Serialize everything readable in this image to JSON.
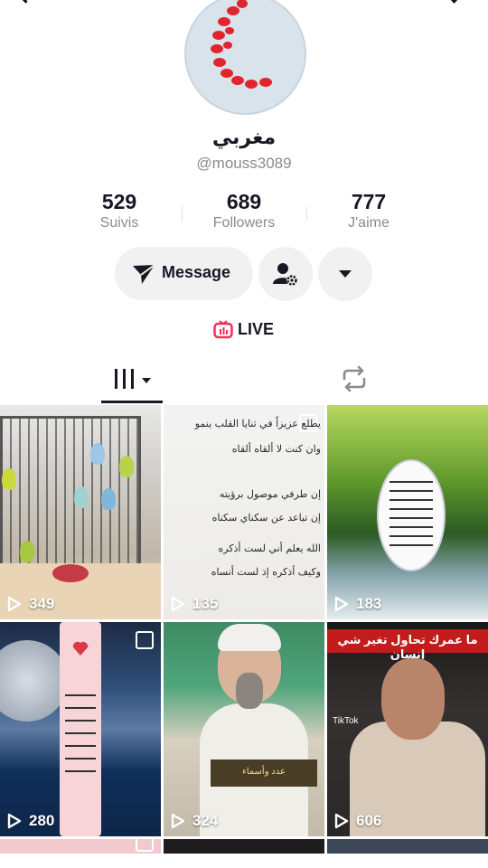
{
  "profile": {
    "nickname": "مغربي",
    "username": "@mouss3089"
  },
  "stats": [
    {
      "value": "529",
      "label": "Suivis"
    },
    {
      "value": "689",
      "label": "Followers"
    },
    {
      "value": "777",
      "label": "J'aime"
    }
  ],
  "actions": {
    "message_label": "Message"
  },
  "live": {
    "label": "LIVE"
  },
  "tiles": [
    {
      "views": "349"
    },
    {
      "views": "135",
      "text_lines": [
        "يطلع عزيزاً في ثنايا القلب ينمو",
        "وان كنت لا ألقاه ألقاه",
        "إن طرفي موصول برؤيته",
        "إن تباعد عن سكناي سكناه",
        "الله يعلم أني لست أذكره",
        "وكيف أذكره إذ لست أنساه"
      ]
    },
    {
      "views": "183"
    },
    {
      "views": "280"
    },
    {
      "views": "324",
      "caption": "عدد وأسماء"
    },
    {
      "views": "606",
      "banner": "ما عمرك تحاول تغير شي إنسان",
      "watermark": "TikTok"
    }
  ],
  "colors": {
    "text": "#161823",
    "secondary_text": "#8a8b91",
    "button_bg": "#f1f1f2",
    "live_accent": "#fe2c55"
  }
}
